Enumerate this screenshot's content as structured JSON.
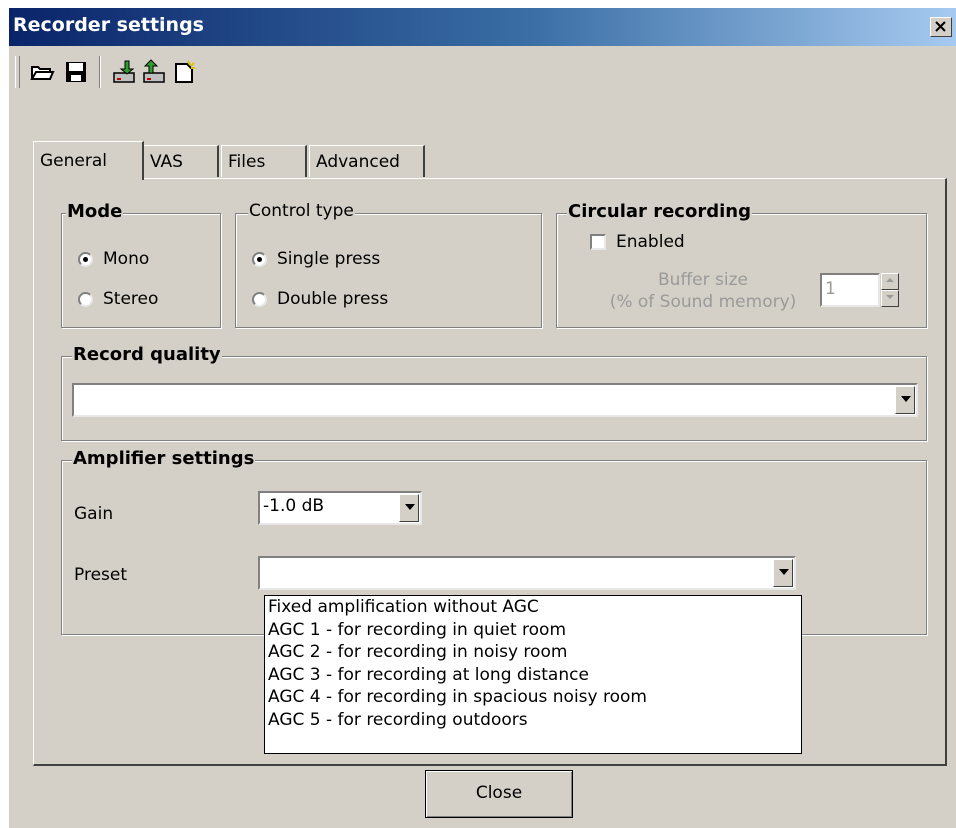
{
  "window": {
    "title": "Recorder settings",
    "close_symbol": "✕"
  },
  "toolbar": {
    "buttons": [
      {
        "icon": "open-folder-icon"
      },
      {
        "icon": "save-disk-icon"
      },
      {
        "icon": "import-device-icon"
      },
      {
        "icon": "export-device-icon"
      },
      {
        "icon": "new-defaults-icon"
      }
    ]
  },
  "tabs": [
    {
      "label": "General",
      "active": true
    },
    {
      "label": "VAS",
      "active": false
    },
    {
      "label": "Files",
      "active": false
    },
    {
      "label": "Advanced",
      "active": false
    }
  ],
  "mode": {
    "label": "Mode",
    "options": [
      {
        "label": "Mono",
        "selected": true
      },
      {
        "label": "Stereo",
        "selected": false
      }
    ]
  },
  "control_type": {
    "label": "Control type",
    "options": [
      {
        "label": "Single press",
        "selected": true
      },
      {
        "label": "Double press",
        "selected": false
      }
    ]
  },
  "circular": {
    "label": "Circular recording",
    "enabled_label": "Enabled",
    "enabled": false,
    "buffer_label_1": "Buffer size",
    "buffer_label_2": "(% of Sound memory)",
    "buffer_value": "1"
  },
  "record_quality": {
    "label": "Record quality",
    "value": ""
  },
  "amplifier": {
    "label": "Amplifier settings",
    "gain_label": "Gain",
    "gain_value": "-1.0 dB",
    "preset_label": "Preset",
    "preset_value": "",
    "preset_options": [
      "Fixed amplification without AGC",
      "AGC 1 - for recording in quiet room",
      "AGC 2 - for recording in noisy room",
      "AGC 3 - for recording at long distance",
      "AGC 4 - for recording in spacious noisy room",
      "AGC 5 - for recording outdoors"
    ]
  },
  "footer": {
    "close_label": "Close"
  }
}
